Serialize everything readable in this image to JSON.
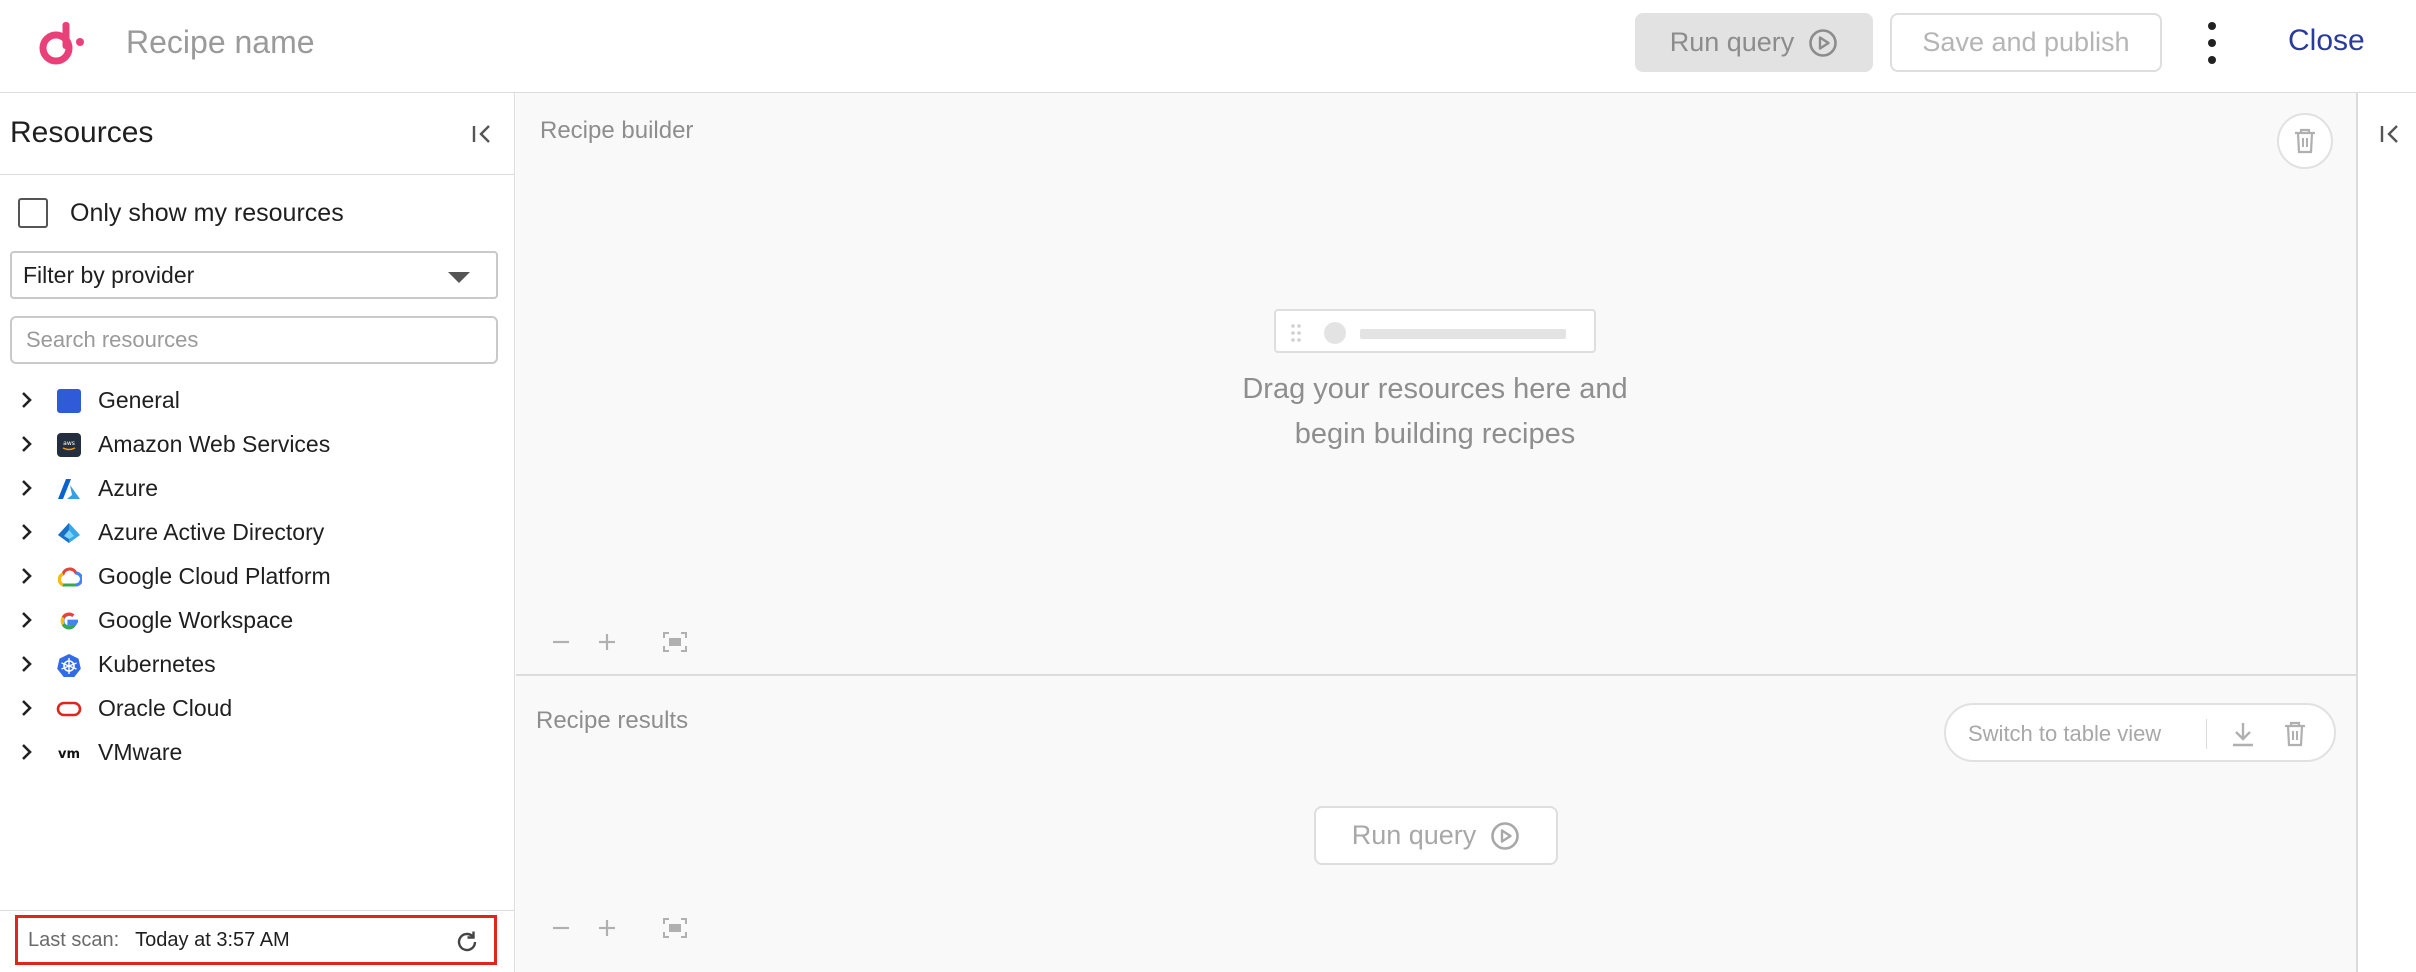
{
  "header": {
    "recipe_name_placeholder": "Recipe name",
    "run_query_label": "Run query",
    "save_publish_label": "Save and publish",
    "close_label": "Close"
  },
  "sidebar": {
    "title": "Resources",
    "only_mine_label": "Only show my resources",
    "filter_label": "Filter by provider",
    "search_placeholder": "Search resources",
    "providers": [
      {
        "label": "General",
        "icon": "general-icon"
      },
      {
        "label": "Amazon Web Services",
        "icon": "aws-icon"
      },
      {
        "label": "Azure",
        "icon": "azure-icon"
      },
      {
        "label": "Azure Active Directory",
        "icon": "azure-ad-icon"
      },
      {
        "label": "Google Cloud Platform",
        "icon": "gcp-icon"
      },
      {
        "label": "Google Workspace",
        "icon": "google-icon"
      },
      {
        "label": "Kubernetes",
        "icon": "kubernetes-icon"
      },
      {
        "label": "Oracle Cloud",
        "icon": "oracle-icon"
      },
      {
        "label": "VMware",
        "icon": "vmware-icon"
      }
    ],
    "last_scan_label": "Last scan:",
    "last_scan_value": "Today at 3:57 AM"
  },
  "builder": {
    "title": "Recipe builder",
    "empty_line1": "Drag your resources here and",
    "empty_line2": "begin building recipes"
  },
  "results": {
    "title": "Recipe results",
    "switch_label": "Switch to table view",
    "run_query_label": "Run query"
  },
  "colors": {
    "brand_logo": "#e9407a",
    "close_link": "#2b3a9f",
    "highlight_border": "#e0251b"
  }
}
